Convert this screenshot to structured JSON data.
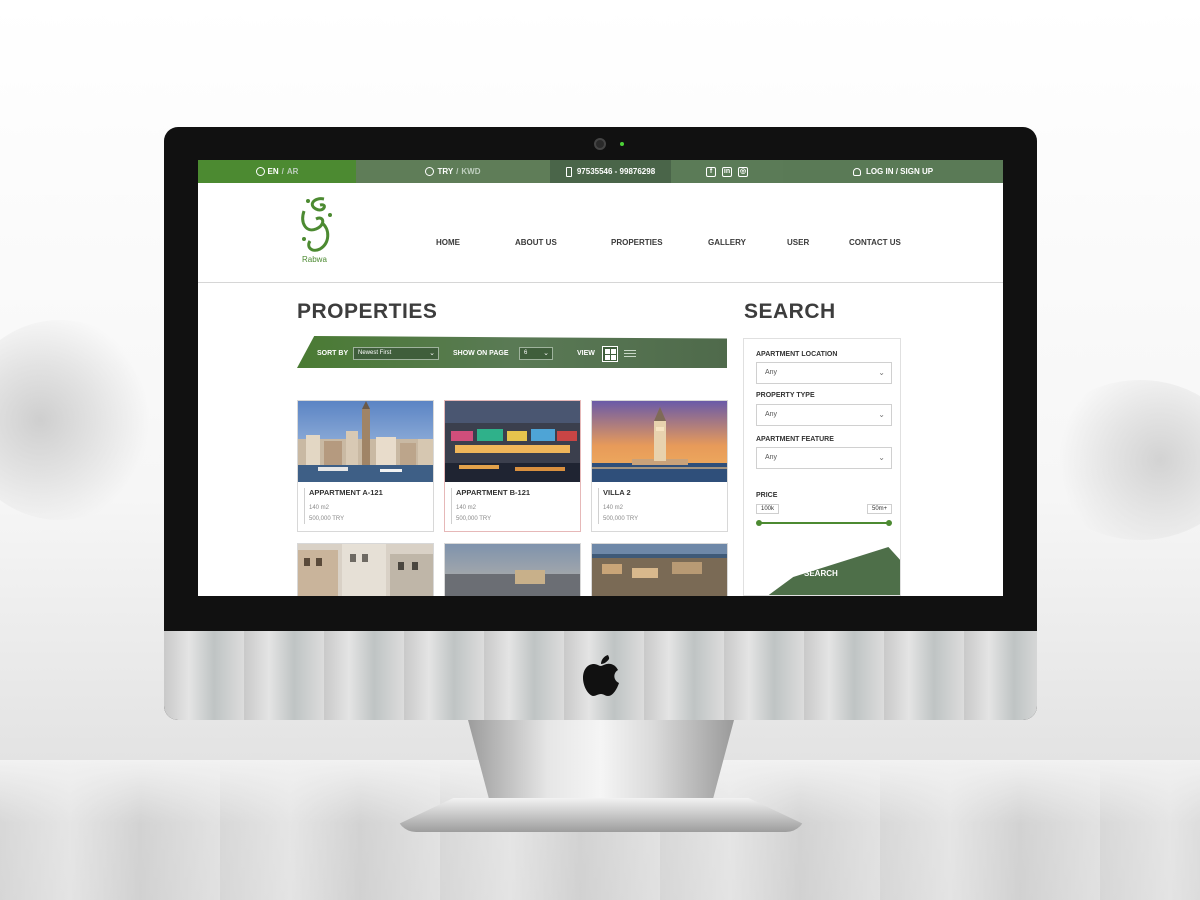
{
  "topbar": {
    "lang_active": "EN",
    "lang_sep": "/",
    "lang_other": "AR",
    "currency_active": "TRY",
    "currency_sep": "/",
    "currency_other": "KWD",
    "phone": "97535546 - 99876298",
    "social_icons": [
      "facebook-icon",
      "linkedin-icon",
      "instagram-icon"
    ],
    "login": "LOG IN / SIGN UP"
  },
  "logo": {
    "name": "Rabwa"
  },
  "nav": [
    "HOME",
    "ABOUT US",
    "PROPERTIES",
    "GALLERY",
    "USER",
    "CONTACT US"
  ],
  "properties": {
    "title": "PROPERTIES",
    "sort_label": "SORT BY",
    "sort_value": "Newest First",
    "show_label": "SHOW ON PAGE",
    "show_value": "6",
    "view_label": "VIEW",
    "cards": [
      {
        "title": "APPARTMENT A-121",
        "area": "140 m2",
        "price": "500,000 TRY"
      },
      {
        "title": "APPARTMENT B-121",
        "area": "140 m2",
        "price": "500,000 TRY"
      },
      {
        "title": "VILLA 2",
        "area": "140 m2",
        "price": "500,000 TRY"
      }
    ]
  },
  "search": {
    "title": "SEARCH",
    "location_label": "APARTMENT LOCATION",
    "location_value": "Any",
    "type_label": "PROPERTY TYPE",
    "type_value": "Any",
    "feature_label": "APARTMENT FEATURE",
    "feature_value": "Any",
    "price_label": "PRICE",
    "price_min": "100k",
    "price_max": "50m+",
    "button": "SEARCH"
  },
  "colors": {
    "brand_green": "#4c8a31",
    "bar_green": "#587a57",
    "heading": "#3d3d3d"
  }
}
